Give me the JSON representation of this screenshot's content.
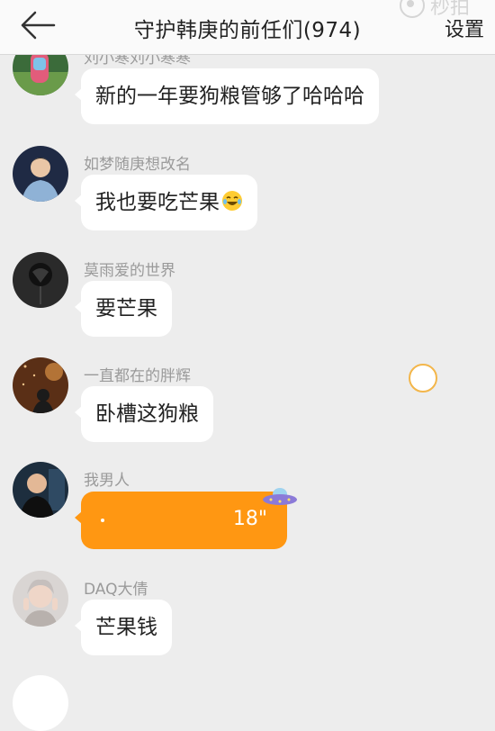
{
  "header": {
    "title": "守护韩庚的前任们(974)",
    "settings_label": "设置",
    "watermark_text": "秒拍"
  },
  "messages": [
    {
      "nick": "刘小寒刘小寒寒",
      "text": "新的一年要狗粮管够了哈哈哈"
    },
    {
      "nick": "如梦随庚想改名",
      "text": "我也要吃芒果"
    },
    {
      "nick": "莫雨爱的世界",
      "text": "要芒果"
    },
    {
      "nick": "一直都在的胖辉",
      "text": "卧槽这狗粮"
    },
    {
      "nick": "我男人",
      "voice_duration": "18\""
    },
    {
      "nick": "DAQ大倩",
      "text": "芒果钱"
    }
  ],
  "icons": {
    "back": "back-arrow-icon",
    "emoji": "laughing-tears-emoji-icon",
    "ufo": "ufo-icon"
  },
  "colors": {
    "voice_bubble": "#ff9712",
    "header_bg": "#fafafa",
    "chat_bg": "#ededed"
  }
}
